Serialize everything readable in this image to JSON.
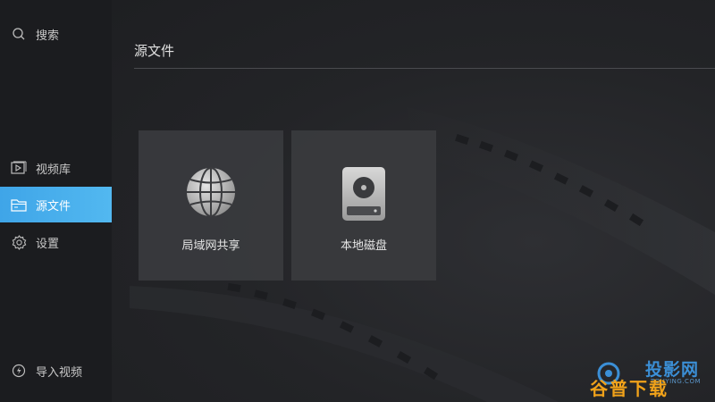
{
  "sidebar": {
    "search_label": "搜索",
    "items": [
      {
        "label": "视频库",
        "icon": "video-library-icon"
      },
      {
        "label": "源文件",
        "icon": "folder-icon",
        "active": true
      },
      {
        "label": "设置",
        "icon": "gear-icon"
      }
    ],
    "import_label": "导入视频"
  },
  "main": {
    "title": "源文件",
    "cards": [
      {
        "label": "局域网共享",
        "icon": "globe-icon"
      },
      {
        "label": "本地磁盘",
        "icon": "hard-disk-icon"
      }
    ]
  },
  "watermark": {
    "line1": "投影网",
    "url": "TOUYING.COM",
    "line2": "谷普下载"
  },
  "colors": {
    "accent": "#4aafec",
    "background": "#1f2023",
    "card": "#3a3b3e"
  }
}
